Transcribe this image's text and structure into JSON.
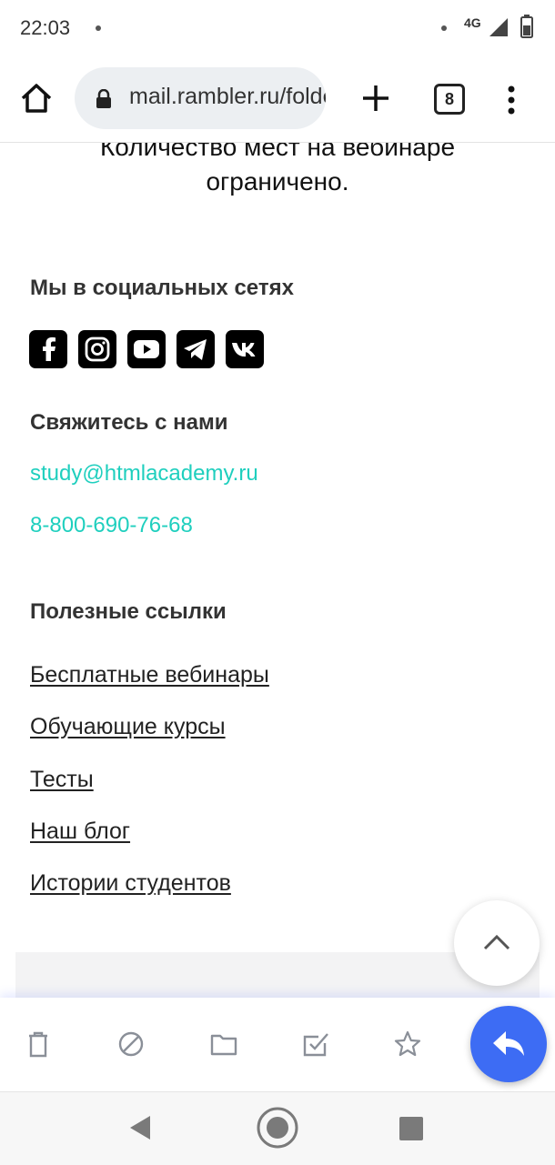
{
  "status_bar": {
    "time": "22:03",
    "network": "4G"
  },
  "browser": {
    "url": "mail.rambler.ru/folder/INBOX",
    "tab_count": "8"
  },
  "notice_text": "Количество мест на вебинаре ограничено.",
  "social": {
    "title": "Мы в социальных сетях",
    "icons": [
      "facebook-icon",
      "instagram-icon",
      "youtube-icon",
      "telegram-icon",
      "vk-icon"
    ]
  },
  "contacts": {
    "title": "Свяжитесь с нами",
    "email": "study@htmlacademy.ru",
    "phone": "8-800-690-76-68"
  },
  "useful_links": {
    "title": "Полезные ссылки",
    "items": [
      "Бесплатные вебинары",
      "Обучающие курсы",
      "Тесты",
      "Наш блог",
      "Истории студентов"
    ]
  },
  "action_bar": {
    "icons": [
      "trash-icon",
      "spam-icon",
      "folder-icon",
      "mark-read-icon",
      "star-icon",
      "reply-icon"
    ]
  },
  "colors": {
    "link": "#1fcfbe",
    "reply_button": "#3d6cf4",
    "social_bg": "#000000"
  }
}
